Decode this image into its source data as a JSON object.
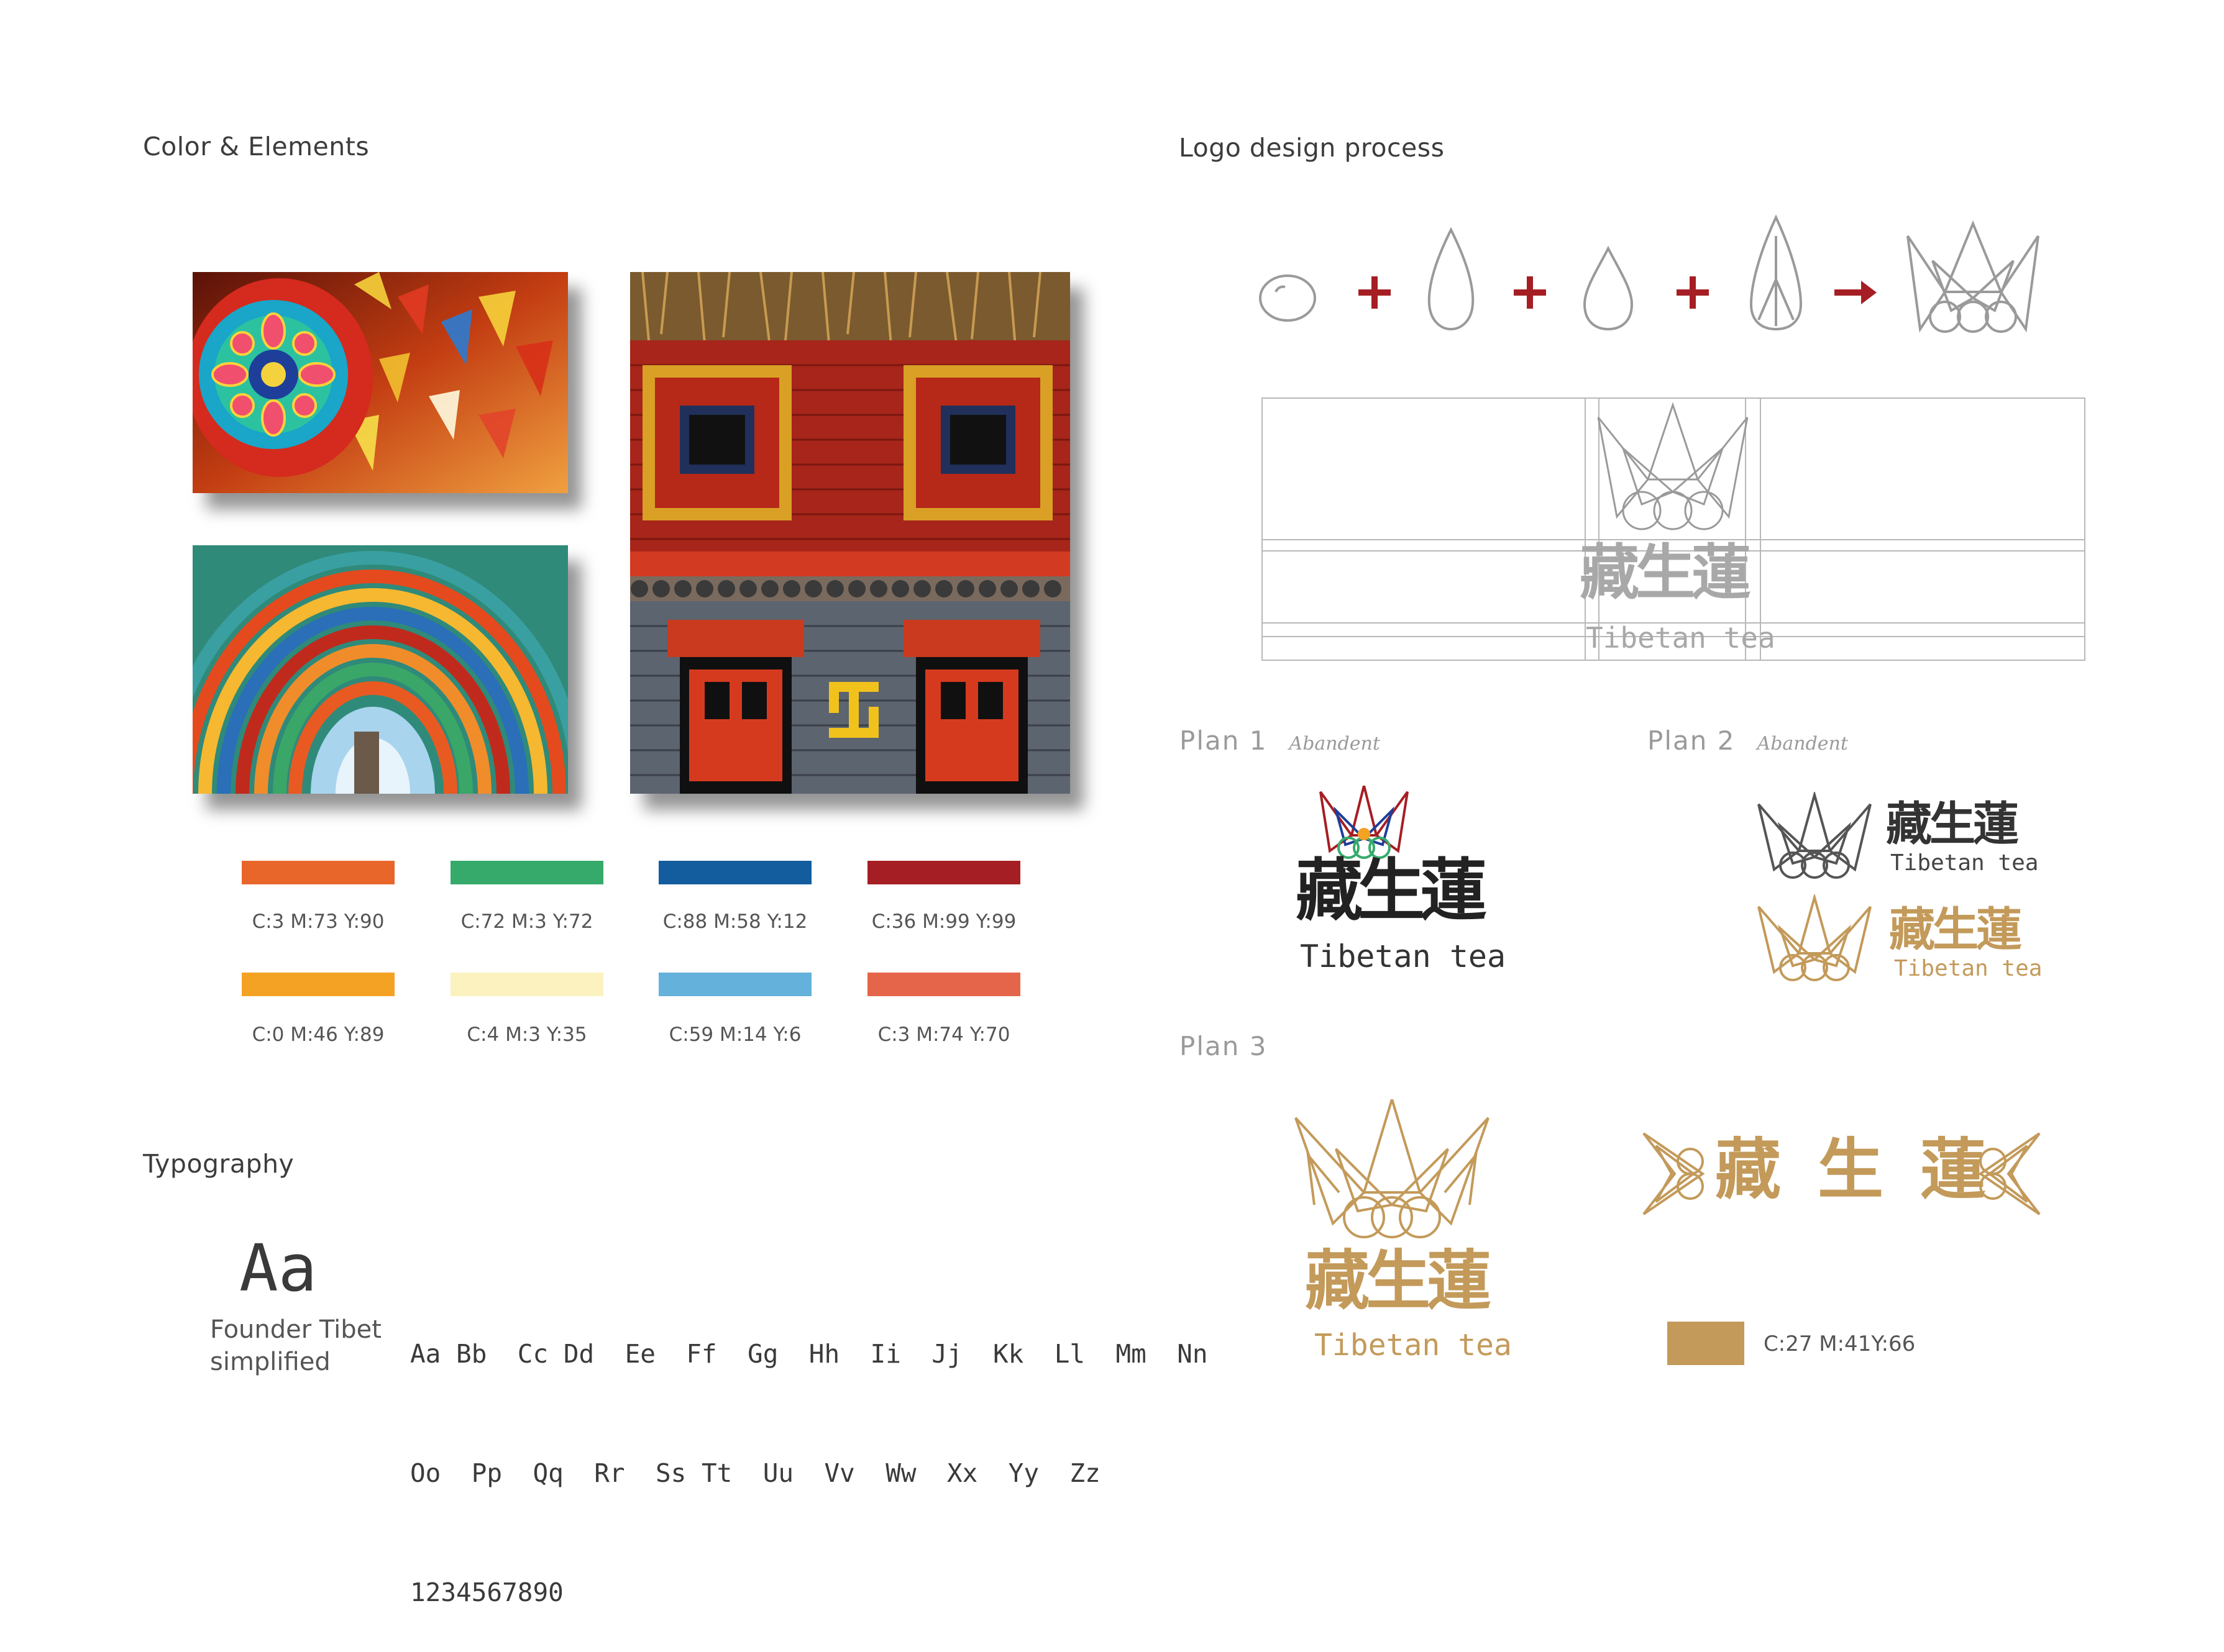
{
  "left": {
    "color_heading": "Color & Elements",
    "swatches": [
      {
        "color": "#E8662A",
        "label": "C:3 M:73 Y:90"
      },
      {
        "color": "#35AA6A",
        "label": "C:72 M:3 Y:72"
      },
      {
        "color": "#135C9E",
        "label": "C:88 M:58 Y:12"
      },
      {
        "color": "#A51E23",
        "label": "C:36 M:99 Y:99"
      },
      {
        "color": "#F4A224",
        "label": "C:0 M:46 Y:89"
      },
      {
        "color": "#FBF2BF",
        "label": "C:4 M:3 Y:35"
      },
      {
        "color": "#64B1DB",
        "label": "C:59 M:14 Y:6"
      },
      {
        "color": "#E5654A",
        "label": "C:3 M:74 Y:70"
      }
    ],
    "typography_heading": "Typography",
    "font_sample": "Aa",
    "font_name_line1": "Founder Tibet",
    "font_name_line2": "simplified",
    "alphabet_line1": "Aa Bb  Cc Dd  Ee  Ff  Gg  Hh  Ii  Jj  Kk  Ll  Mm  Nn",
    "alphabet_line2": "Oo  Pp  Qq  Rr  Ss Tt  Uu  Vv  Ww  Xx  Yy  Zz",
    "digits_line": "1234567890"
  },
  "right": {
    "logo_heading": "Logo design process",
    "process_plus": "+",
    "process_arrow": "→",
    "brand_cn": "藏生蓮",
    "brand_cn_char1": "藏",
    "brand_cn_char2": "生",
    "brand_cn_char3": "蓮",
    "brand_en": "Tibetan tea",
    "plan1_title": "Plan  1",
    "plan1_status": "Abandent",
    "plan2_title": "Plan  2",
    "plan2_status": "Abandent",
    "plan3_title": "Plan  3",
    "gold_color": "#C39A5A",
    "gold_label": "C:27 M:41Y:66"
  }
}
